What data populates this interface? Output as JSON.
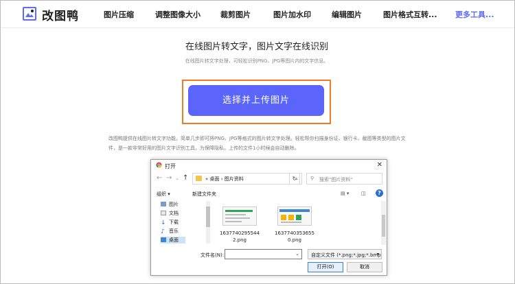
{
  "header": {
    "logo_text": "改图鸭",
    "nav": [
      "图片压缩",
      "调整图像大小",
      "裁剪图片",
      "图片加水印",
      "编辑图片",
      "图片格式互转..."
    ],
    "more": "更多工具...",
    "accent": "#5b6bff"
  },
  "hero": {
    "title": "在线图片转文字，图片文字在线识别",
    "subtitle": "在线图片转文字处理，可轻松识别PNG、JPG等图片内的文字信息。",
    "upload_label": "选择并上传图片",
    "button_color": "#5b65fb",
    "highlight_color": "#f07a25",
    "description": "改图鸭提供在线图片转文字功能，简单几步即可将PNG、JPG等格式的图片转文字处理。轻松帮你扫描身份证、银行卡、截图等类型的图片文件，是一款非常好用的图片文字识别工具，为保障隐私，上传的文件1小时候会自动删除。"
  },
  "dialog": {
    "title": "打开",
    "close": "✕",
    "address": "« 桌面 › 图片资料",
    "search_placeholder": "搜索\"图片资料\"",
    "toolbar": {
      "organize": "组织 ▾",
      "new_folder": "新建文件夹"
    },
    "tree": [
      "图片",
      "文档",
      "下载",
      "音乐",
      "桌面"
    ],
    "files": [
      {
        "name_line1": "1637740295544",
        "name_line2": "2.png"
      },
      {
        "name_line1": "1637740353655",
        "name_line2": "0.png"
      }
    ],
    "filename_label": "文件名(N):",
    "filetype": "自定义文件 (*.png;*.jpg;*.bmp",
    "open_button": "打开(O)",
    "cancel_button": "取消"
  }
}
